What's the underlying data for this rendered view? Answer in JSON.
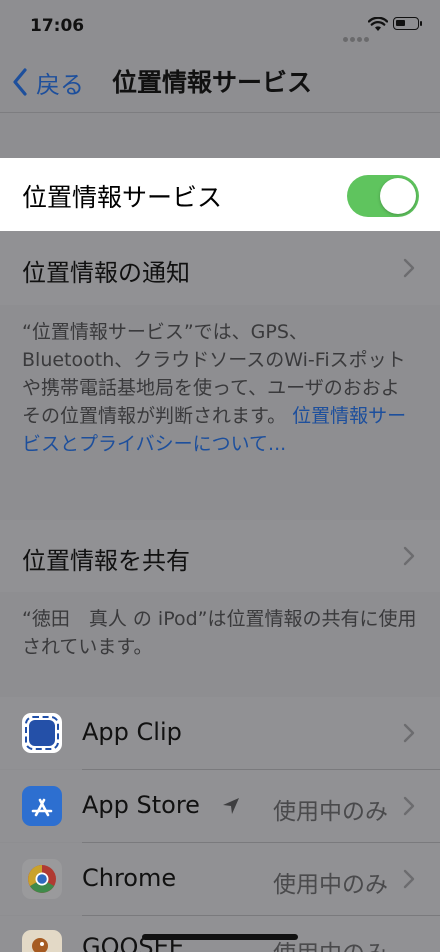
{
  "status_bar": {
    "time": "17:06"
  },
  "nav": {
    "back_label": "戻る",
    "title": "位置情報サービス"
  },
  "location_services": {
    "label": "位置情報サービス",
    "enabled": true
  },
  "alerts_row": {
    "label": "位置情報の通知"
  },
  "description": {
    "text": "“位置情報サービス”では、GPS、Bluetooth、クラウドソースのWi-Fiスポットや携帯電話基地局を使って、ユーザのおおよその位置情報が判断されます。",
    "link": "位置情報サービスとプライバシーについて..."
  },
  "share_row": {
    "label": "位置情報を共有"
  },
  "share_note": "“徳田　真人 の iPod”は位置情報の共有に使用されています。",
  "apps": [
    {
      "name": "App Clip",
      "status": ""
    },
    {
      "name": "App Store",
      "status": "使用中のみ"
    },
    {
      "name": "Chrome",
      "status": "使用中のみ"
    },
    {
      "name": "GOOSEE",
      "status": "使用中のみ"
    }
  ],
  "colors": {
    "toggle_on": "#5fc45e",
    "link": "#1d4f9c"
  }
}
